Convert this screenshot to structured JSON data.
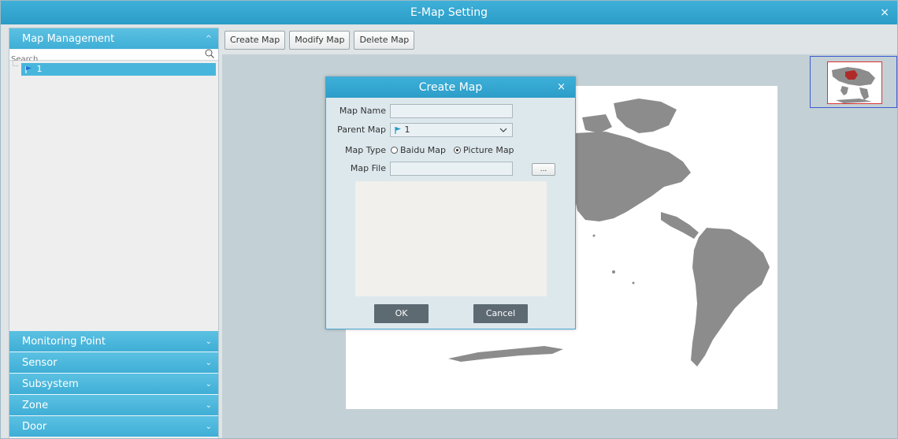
{
  "window": {
    "title": "E-Map Setting",
    "close_glyph": "×"
  },
  "sidebar": {
    "map_management": {
      "label": "Map Management",
      "chevron": "^"
    },
    "search": {
      "placeholder": "Search"
    },
    "tree": [
      {
        "label": "1",
        "icon": "map-flag-icon"
      }
    ],
    "sections": [
      {
        "key": "monitoring-point",
        "label": "Monitoring Point",
        "chevron": "⌄"
      },
      {
        "key": "sensor",
        "label": "Sensor",
        "chevron": "⌄"
      },
      {
        "key": "subsystem",
        "label": "Subsystem",
        "chevron": "⌄"
      },
      {
        "key": "zone",
        "label": "Zone",
        "chevron": "⌄"
      },
      {
        "key": "door",
        "label": "Door",
        "chevron": "⌄"
      }
    ]
  },
  "toolbar": {
    "create_label": "Create Map",
    "modify_label": "Modify Map",
    "delete_label": "Delete Map"
  },
  "dialog": {
    "title": "Create Map",
    "close_glyph": "×",
    "map_name_label": "Map Name",
    "map_name_value": "",
    "parent_map_label": "Parent Map",
    "parent_map_value": "1",
    "map_type_label": "Map Type",
    "map_type_options": [
      "Baidu Map",
      "Picture Map"
    ],
    "map_type_selected": "Picture Map",
    "map_file_label": "Map File",
    "map_file_value": "",
    "browse_label": "...",
    "ok_label": "OK",
    "cancel_label": "Cancel"
  },
  "colors": {
    "accent": "#2a9cc7",
    "accent_light": "#48b6dc",
    "land": "#8c8c8c",
    "dialog_button": "#5d6a72"
  }
}
